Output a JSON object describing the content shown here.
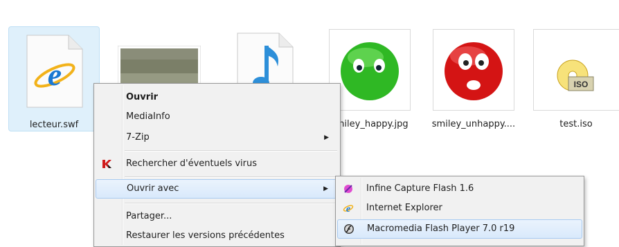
{
  "files": [
    {
      "name": "lecteur.swf",
      "icon": "ie-document-icon"
    },
    {
      "name": "",
      "icon": "landscape-thumbnail-icon"
    },
    {
      "name": "",
      "icon": "audio-file-icon"
    },
    {
      "name": "smiley_happy.jpg",
      "icon": "green-smiley-icon"
    },
    {
      "name": "smiley_unhappy....",
      "icon": "red-smiley-icon"
    },
    {
      "name": "test.iso",
      "icon": "iso-disc-icon"
    }
  ],
  "context_menu": {
    "open": "Ouvrir",
    "mediainfo": "MediaInfo",
    "sevenzip": "7-Zip",
    "virus_scan": "Rechercher d'éventuels virus",
    "open_with": "Ouvrir avec",
    "share": "Partager...",
    "restore": "Restaurer les versions précédentes"
  },
  "open_with_menu": [
    {
      "label": "Infine Capture Flash 1.6",
      "icon": "capture-flash-icon"
    },
    {
      "label": "Internet Explorer",
      "icon": "internet-explorer-icon"
    },
    {
      "label": "Macromedia Flash Player 7.0  r19",
      "icon": "flash-player-icon"
    }
  ]
}
